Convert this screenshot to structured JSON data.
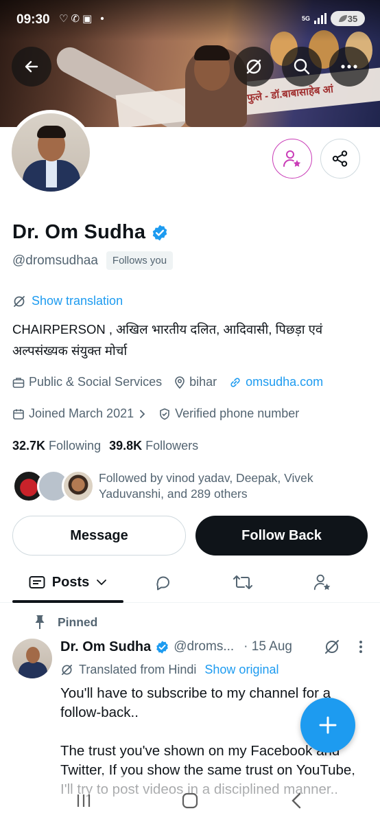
{
  "status_bar": {
    "time": "09:30",
    "left_icons": "♡✆▣ •",
    "network": "5G",
    "battery": "35"
  },
  "banner": {
    "text": "फुले - डॉ.बाबासाहेब आं"
  },
  "profile": {
    "name": "Dr. Om Sudha",
    "handle": "@dromsudhaa",
    "follows_you": "Follows you",
    "show_translation": "Show translation",
    "bio": "CHAIRPERSON , अखिल भारतीय दलित, आदिवासी, पिछड़ा एवं अल्पसंख्यक संयुक्त मोर्चा",
    "category": "Public & Social Services",
    "location": "bihar",
    "website": "omsudha.com",
    "joined": "Joined March 2021",
    "verified_phone": "Verified phone number",
    "following_count": "32.7K",
    "following_label": "Following",
    "followers_count": "39.8K",
    "followers_label": "Followers",
    "followed_by": "Followed by vinod yadav, Deepak, Vivek Yaduvanshi, and 289 others"
  },
  "buttons": {
    "message": "Message",
    "follow_back": "Follow Back"
  },
  "tabs": {
    "posts": "Posts"
  },
  "pinned_post": {
    "pinned_label": "Pinned",
    "name": "Dr. Om Sudha",
    "handle": "@droms...",
    "time": "· 15 Aug",
    "translated_from": "Translated from Hindi",
    "show_original": "Show original",
    "text": "You'll have to subscribe to my channel for a follow-back..\n\nThe trust you've shown on my Facebook and Twitter, If you show the same trust on YouTube, I'll try to post videos in a disciplined manner.."
  },
  "colors": {
    "accent": "#1d9bf0",
    "text": "#0f1419",
    "secondary": "#536471",
    "subscribe": "#c93cb7"
  },
  "icons": [
    "back-arrow-icon",
    "grok-icon",
    "search-icon",
    "more-icon",
    "subscribe-icon",
    "share-icon",
    "verified-badge-icon",
    "briefcase-icon",
    "location-icon",
    "link-icon",
    "calendar-icon",
    "shield-check-icon",
    "chevron-right-icon",
    "pin-icon",
    "reply-icon",
    "retweet-icon",
    "compose-plus-icon"
  ]
}
